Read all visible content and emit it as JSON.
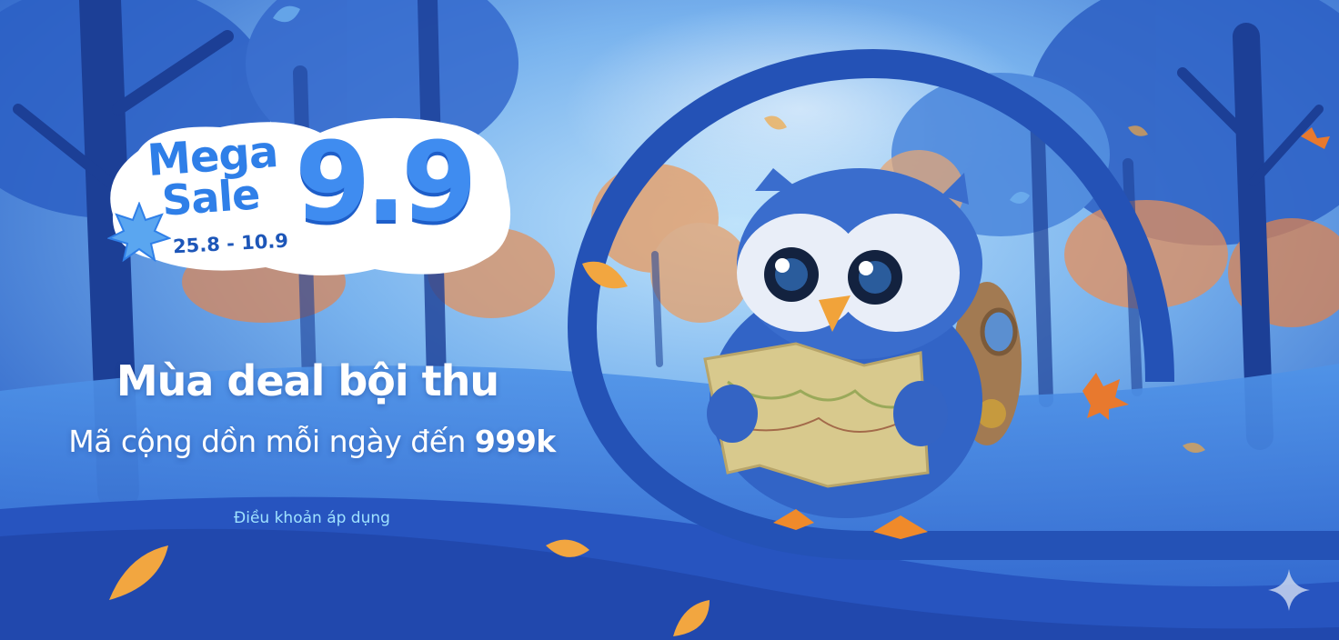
{
  "logo": {
    "word1": "Mega",
    "word2": "Sale",
    "number": "9.9",
    "dates": "25.8 - 10.9"
  },
  "headline": "Mùa deal bội thu",
  "subline": {
    "text": "Mã cộng dồn mỗi ngày đến ",
    "highlight": "999k"
  },
  "terms_link": "Điều khoản áp dụng",
  "icons": {
    "mascot": "owl-mascot-with-map",
    "leaf": "maple-leaf-icon",
    "sparkle": "sparkle-icon"
  },
  "colors": {
    "brand_blue": "#2f7fe8",
    "dark_blue": "#1d56b8",
    "swirl": "#2452b6",
    "terms": "#9fe2ff"
  }
}
